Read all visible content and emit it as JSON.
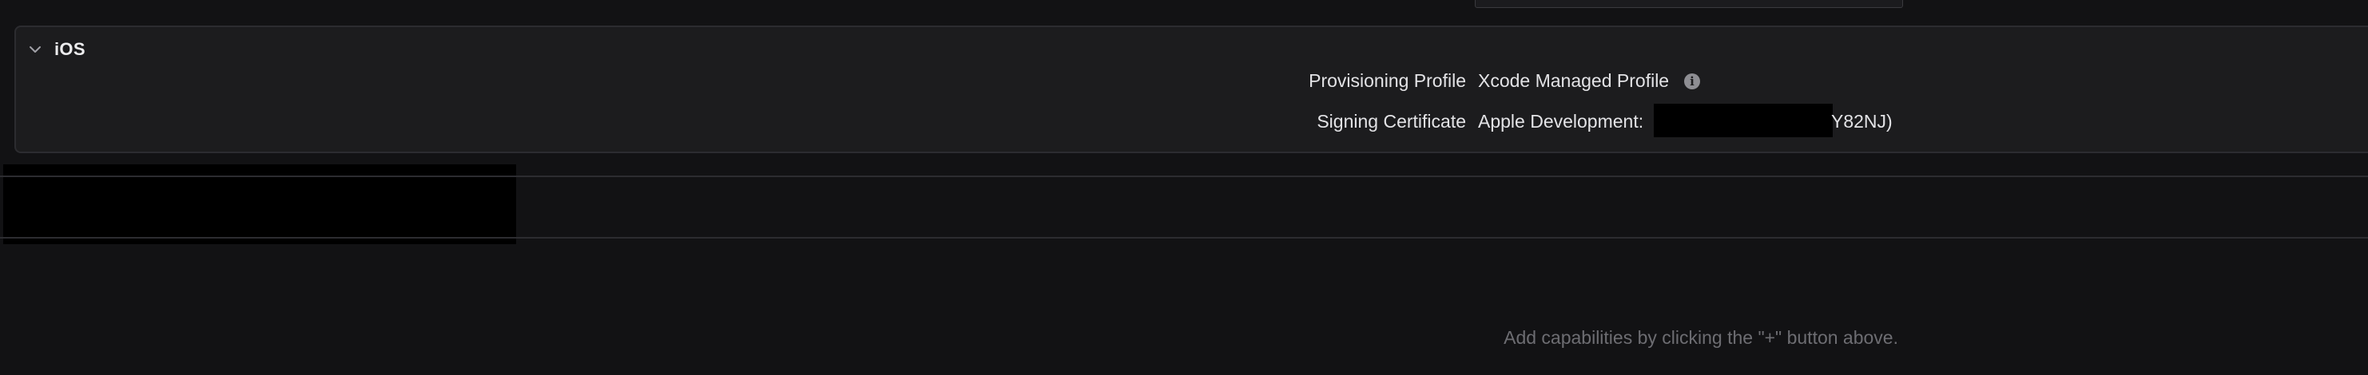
{
  "ios": {
    "title": "iOS",
    "provisioning_profile": {
      "label": "Provisioning Profile",
      "value": "Xcode Managed Profile"
    },
    "signing_certificate": {
      "label": "Signing Certificate",
      "value_prefix": "Apple Development:",
      "value_suffix": "Y82NJ)"
    }
  },
  "capabilities": {
    "hint": "Add capabilities by clicking the \"+\" button above."
  },
  "icons": {
    "section_toggle": "chevron-down-icon",
    "profile_info": "info-icon"
  }
}
